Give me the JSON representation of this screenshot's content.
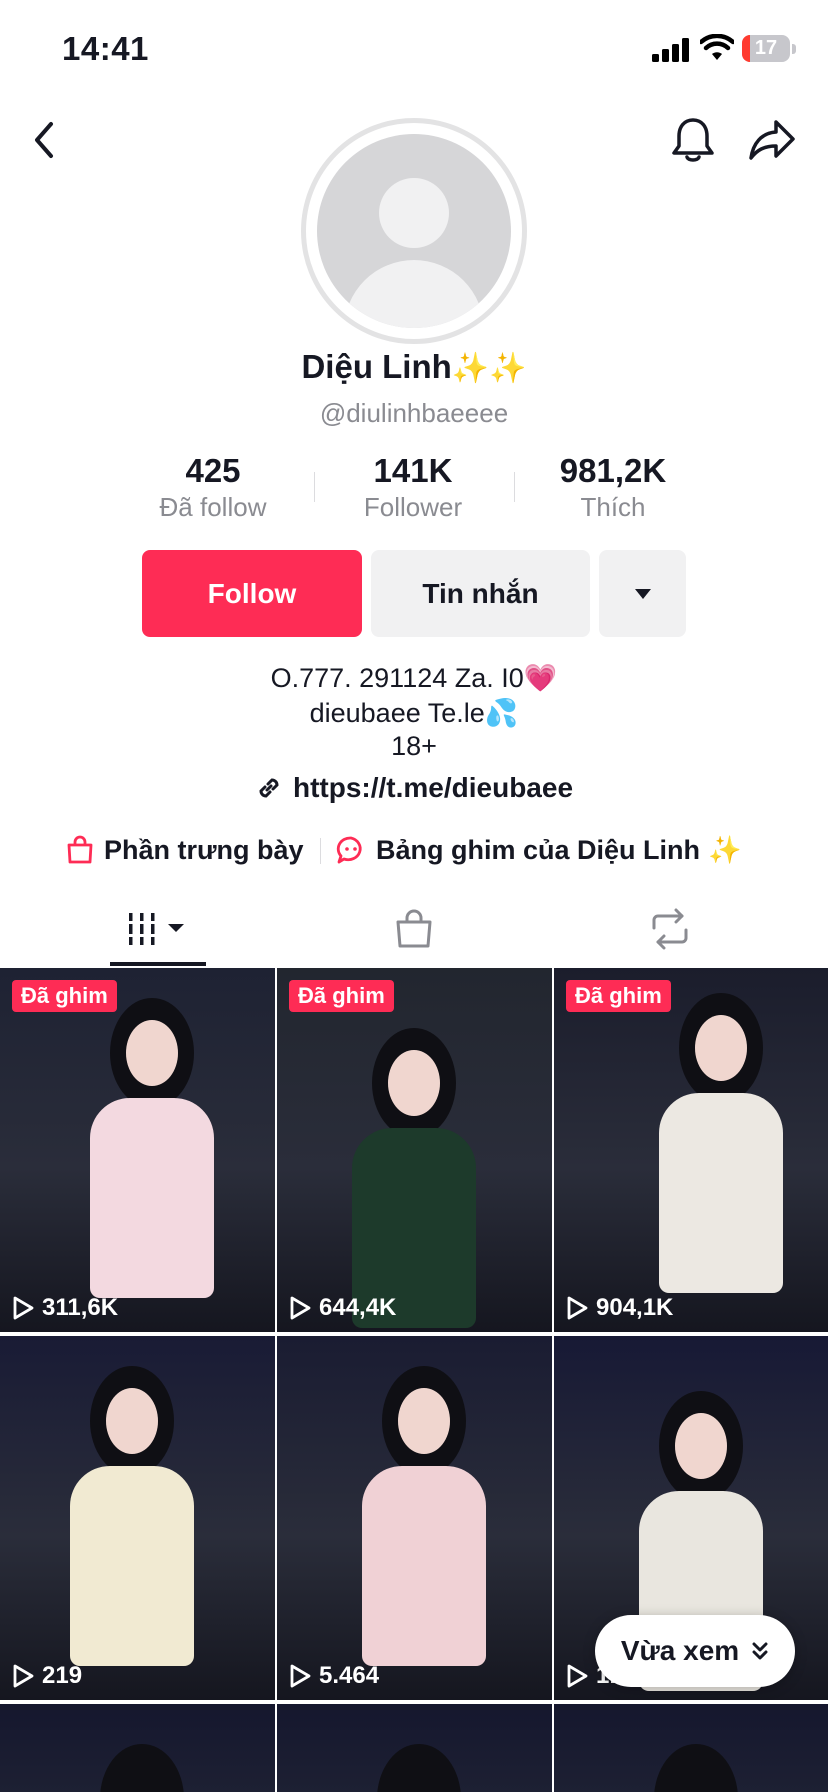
{
  "status_bar": {
    "time": "14:41",
    "battery": "17",
    "battery_level": 0.17
  },
  "profile": {
    "display_name": "Diệu Linh",
    "name_emoji": "✨✨",
    "handle": "@diulinhbaeeee",
    "stats": [
      {
        "value": "425",
        "label": "Đã follow"
      },
      {
        "value": "141K",
        "label": "Follower"
      },
      {
        "value": "981,2K",
        "label": "Thích"
      }
    ],
    "follow_label": "Follow",
    "message_label": "Tin nhắn",
    "bio": [
      "O.777. 291124 Za. I0💗",
      "dieubaee Te.le💦",
      "18+"
    ],
    "link": "https://t.me/dieubaee",
    "showcase_label": "Phần trưng bày",
    "pinboard_label": "Bảng ghim của Diệu Linh",
    "pinboard_emoji": "✨"
  },
  "tabs": [
    {
      "icon": "grid-icon",
      "active": true
    },
    {
      "icon": "shopping-bag-icon",
      "active": false
    },
    {
      "icon": "repost-icon",
      "active": false
    }
  ],
  "videos": [
    {
      "pinned": true,
      "pinned_label": "Đã ghim",
      "views": "311,6K",
      "bg": "#1e2233"
    },
    {
      "pinned": true,
      "pinned_label": "Đã ghim",
      "views": "644,4K",
      "bg": "#22262f"
    },
    {
      "pinned": true,
      "pinned_label": "Đã ghim",
      "views": "904,1K",
      "bg": "#1b1d2c"
    },
    {
      "pinned": false,
      "pinned_label": "",
      "views": "219",
      "bg": "#191b35"
    },
    {
      "pinned": false,
      "pinned_label": "",
      "views": "5.464",
      "bg": "#1a1c32"
    },
    {
      "pinned": false,
      "pinned_label": "",
      "views": "1.5..",
      "bg": "#171935"
    }
  ],
  "recent_button": {
    "label": "Vừa xem"
  },
  "colors": {
    "accent": "#fe2c55",
    "text": "#161823",
    "secondary_text": "#8a8b91",
    "button_bg": "#f1f1f2"
  }
}
